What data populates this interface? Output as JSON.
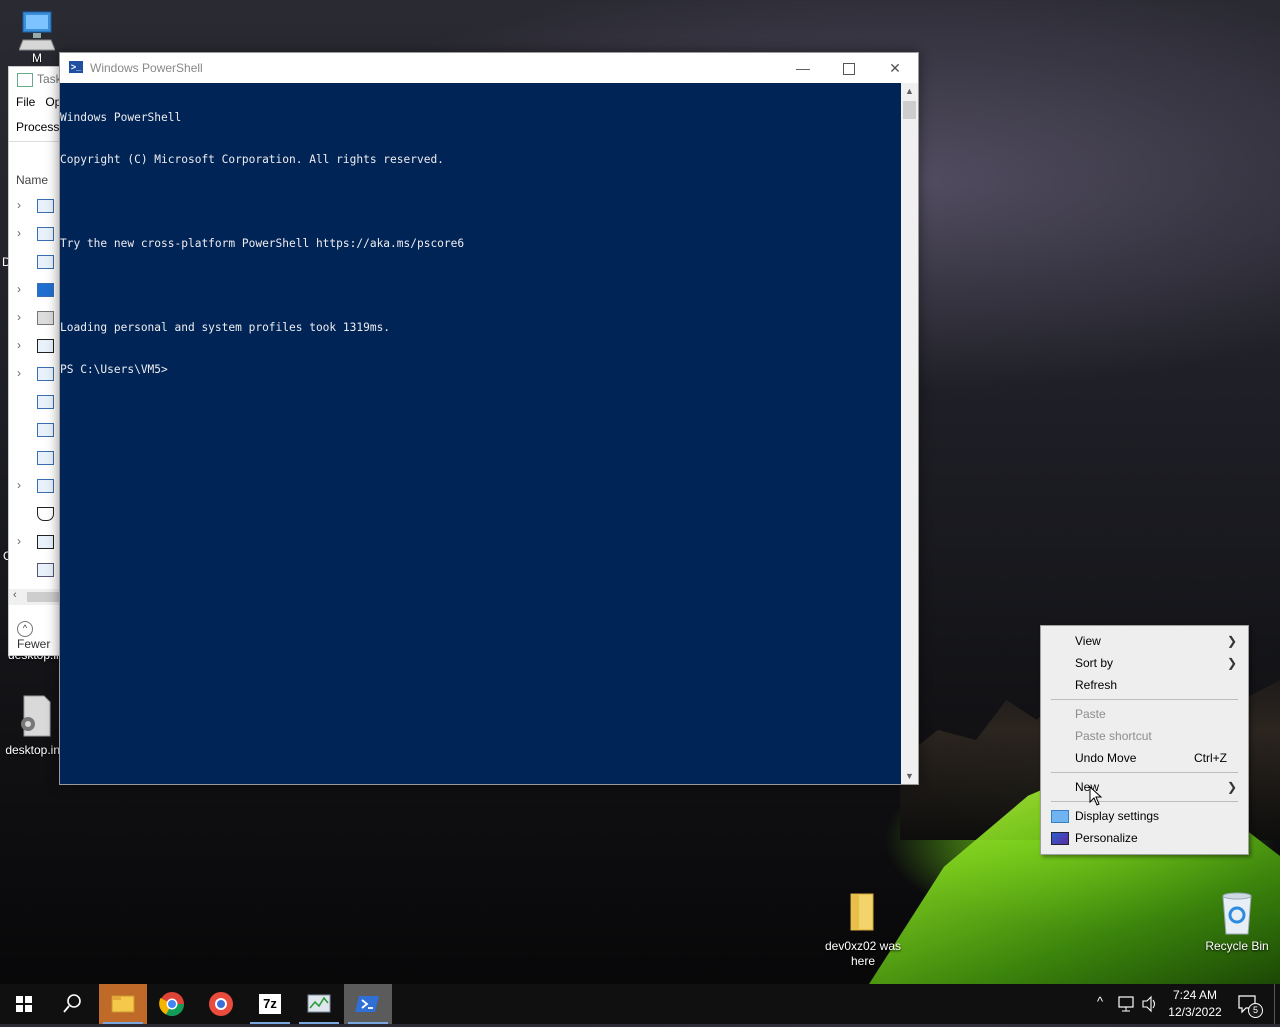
{
  "desktop": {
    "icons": [
      {
        "label": "M"
      },
      {
        "label": "desktop.ini"
      },
      {
        "label": "desktop.ini"
      },
      {
        "label": "dev0xz02 was here"
      },
      {
        "label": "Recycle Bin"
      }
    ],
    "edge_letters": [
      "D",
      "C"
    ]
  },
  "task_manager": {
    "title": "Task",
    "menu": [
      "File",
      "Op"
    ],
    "tab": "Processes",
    "column": "Name",
    "fewer_label": "Fewer"
  },
  "powershell": {
    "title": "Windows PowerShell",
    "lines": [
      "Windows PowerShell",
      "Copyright (C) Microsoft Corporation. All rights reserved.",
      "",
      "Try the new cross-platform PowerShell https://aka.ms/pscore6",
      "",
      "Loading personal and system profiles took 1319ms.",
      "PS C:\\Users\\VM5>"
    ]
  },
  "context_menu": {
    "items": [
      {
        "label": "View",
        "submenu": true
      },
      {
        "label": "Sort by",
        "submenu": true
      },
      {
        "label": "Refresh"
      },
      {
        "label": "Paste",
        "disabled": true
      },
      {
        "label": "Paste shortcut",
        "disabled": true
      },
      {
        "label": "Undo Move",
        "shortcut": "Ctrl+Z"
      },
      {
        "label": "New",
        "submenu": true
      },
      {
        "label": "Display settings",
        "icon": "display-icon"
      },
      {
        "label": "Personalize",
        "icon": "personalize-icon"
      }
    ]
  },
  "taskbar": {
    "apps": [
      "start-icon",
      "search-icon",
      "file-explorer-icon",
      "chrome-icon",
      "chrome-alt-icon",
      "7zip-icon",
      "task-manager-icon",
      "powershell-icon"
    ],
    "seven_zip_label": "7z",
    "time": "7:24 AM",
    "date": "12/3/2022",
    "notification_count": "5"
  },
  "colors": {
    "console_bg": "#012456",
    "console_fg": "#eeedf0",
    "menu_bg": "#eeeeee",
    "taskbar_bg": "#101010",
    "taskbar_highlight": "#c06a2a"
  }
}
